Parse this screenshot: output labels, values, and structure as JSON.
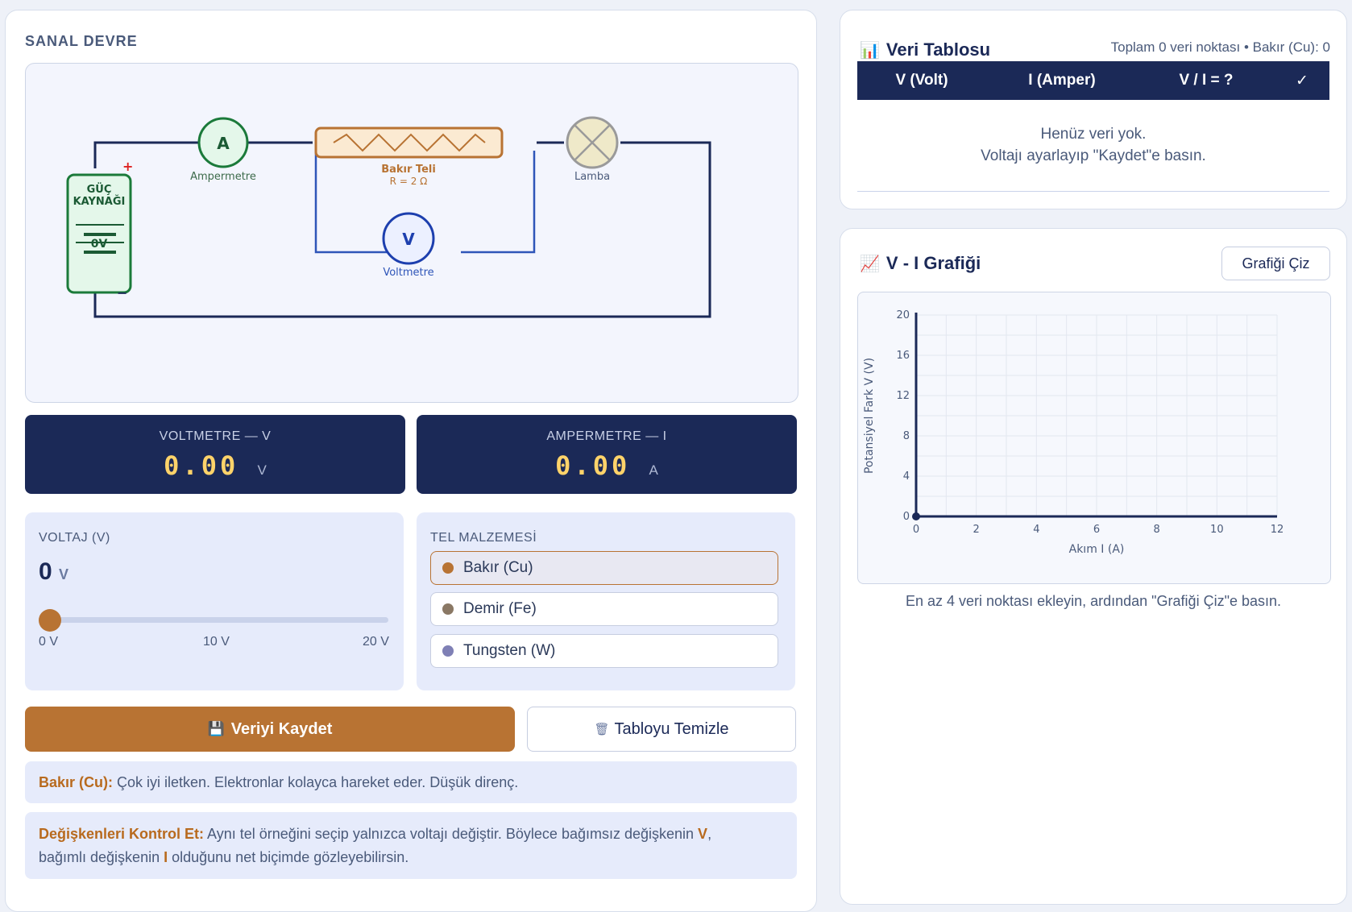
{
  "circuit": {
    "section_title": "SANAL DEVRE",
    "source_label_1": "GÜÇ",
    "source_label_2": "KAYNAĞI",
    "source_value": "0V",
    "plus": "+",
    "minus": "−",
    "ammeter_symbol": "A",
    "ammeter_label": "Ampermetre",
    "wire_label": "Bakır Teli",
    "wire_resistance": "R = 2 Ω",
    "lamp_label": "Lamba",
    "voltmeter_symbol": "V",
    "voltmeter_label": "Voltmetre"
  },
  "meters": {
    "voltmeter_label": "VOLTMETRE — V",
    "voltmeter_value": "0.00",
    "voltmeter_unit": "V",
    "ammeter_label": "AMPERMETRE — I",
    "ammeter_value": "0.00",
    "ammeter_unit": "A"
  },
  "voltage": {
    "caption": "VOLTAJ (V)",
    "value": "0",
    "unit": "V",
    "slider_fraction": 0,
    "tick_min": "0 V",
    "tick_mid": "10 V",
    "tick_max": "20 V"
  },
  "material": {
    "caption": "TEL MALZEMESİ",
    "options": [
      {
        "label": "Bakır (Cu)",
        "color": "#b87333",
        "selected": true
      },
      {
        "label": "Demir (Fe)",
        "color": "#8a7864",
        "selected": false
      },
      {
        "label": "Tungsten (W)",
        "color": "#7f80b5",
        "selected": false
      }
    ]
  },
  "actions": {
    "save_icon": "💾",
    "save_label": "Veriyi Kaydet",
    "clear_icon": "🗑",
    "clear_label": "Tabloyu Temizle"
  },
  "info": {
    "material_title": "Bakır (Cu):",
    "material_text": " Çok iyi iletken. Elektronlar kolayca hareket eder. Düşük direnç.",
    "control_title": "Değişkenleri Kontrol Et:",
    "control_text_1": " Aynı tel örneğini seçip yalnızca voltajı değiştir. Böylece bağımsız değişkenin ",
    "control_var_v": "V",
    "control_text_2": ",",
    "control_text_3": "bağımlı değişkenin ",
    "control_var_i": "I",
    "control_text_4": " olduğunu net biçimde gözleyebilirsin."
  },
  "table": {
    "icon": "📊",
    "title": "Veri Tablosu",
    "summary": "Toplam 0 veri noktası • Bakır (Cu): 0",
    "columns": [
      "V (Volt)",
      "I (Amper)",
      "V / I = ?",
      "✓"
    ],
    "empty_line_1": "Henüz veri yok.",
    "empty_line_2": "Voltajı ayarlayıp \"Kaydet\"e basın."
  },
  "graph": {
    "icon": "📈",
    "title": "V - I Grafiği",
    "plot_button": "Grafiği Çiz",
    "hint": "En az 4 veri noktası ekleyin, ardından \"Grafiği Çiz\"e basın."
  },
  "chart_data": {
    "type": "scatter",
    "xlabel": "Akım I (A)",
    "ylabel": "Potansiyel Fark V (V)",
    "xlim": [
      0,
      12
    ],
    "ylim": [
      0,
      20
    ],
    "xticks": [
      "0",
      "2",
      "4",
      "6",
      "8",
      "10",
      "12"
    ],
    "yticks": [
      "0",
      "4",
      "8",
      "12",
      "16",
      "20"
    ],
    "grid": true,
    "points": [
      {
        "x": 0,
        "y": 0
      }
    ]
  }
}
